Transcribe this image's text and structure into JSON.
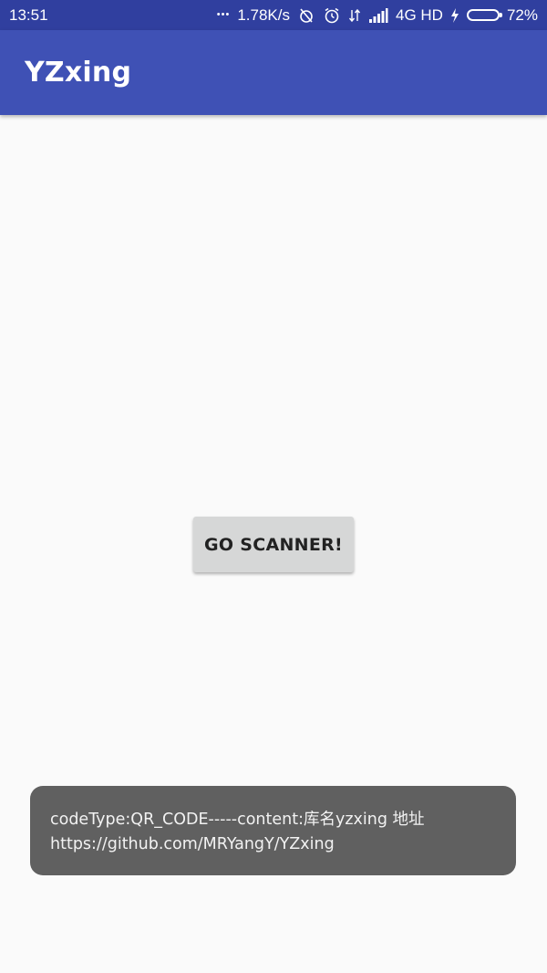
{
  "status_bar": {
    "time": "13:51",
    "dots": "•••",
    "net_speed": "1.78K/s",
    "network": "4G HD",
    "battery_percent": "72%",
    "battery_level": 0.72,
    "icons": [
      "more-dots-icon",
      "alarm-off-icon",
      "alarm-clock-icon",
      "data-transfer-icon",
      "signal-icon",
      "charging-icon",
      "battery-icon"
    ]
  },
  "toolbar": {
    "title": "YZxing"
  },
  "main": {
    "scan_button_label": "GO SCANNER!"
  },
  "toast": {
    "line1": "codeType:QR_CODE-----content:库名yzxing   地址",
    "line2": "https://github.com/MRYangY/YZxing"
  },
  "colors": {
    "status_bar": "#303f9f",
    "toolbar": "#3f51b5",
    "background": "#fafafa",
    "button": "#d6d7d7",
    "toast": "#606060",
    "battery_fill": "#5bd14a"
  }
}
